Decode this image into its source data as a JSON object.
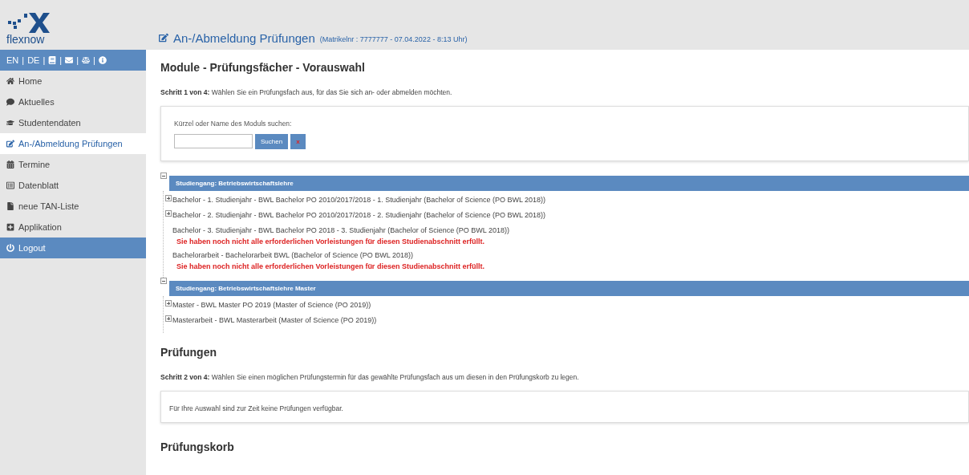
{
  "brand": {
    "name": "flexnow"
  },
  "header": {
    "title": "An-/Abmeldung Prüfungen",
    "subtitle": "(Matrikelnr : 7777777 - 07.04.2022 - 8:13 Uhr)"
  },
  "lang_bar": {
    "separator": "|",
    "items": [
      {
        "kind": "text",
        "label": "EN"
      },
      {
        "kind": "text",
        "label": "DE"
      },
      {
        "kind": "icon"
      },
      {
        "kind": "icon"
      },
      {
        "kind": "icon"
      },
      {
        "kind": "icon"
      }
    ]
  },
  "sidebar": {
    "items": [
      {
        "label": "Home",
        "kind": "link",
        "selected": false
      },
      {
        "label": "Aktuelles",
        "kind": "link",
        "selected": false
      },
      {
        "label": "Studentendaten",
        "kind": "link",
        "selected": false
      },
      {
        "label": "An-/Abmeldung Prüfungen",
        "kind": "link",
        "selected": true
      },
      {
        "label": "Termine",
        "kind": "link",
        "selected": false
      },
      {
        "label": "Datenblatt",
        "kind": "link",
        "selected": false
      },
      {
        "label": "neue TAN-Liste",
        "kind": "link",
        "selected": false
      },
      {
        "label": "Applikation",
        "kind": "link",
        "selected": false
      },
      {
        "label": "Logout",
        "kind": "logout",
        "selected": false
      }
    ]
  },
  "section1": {
    "heading": "Module - Prüfungsfächer - Vorauswahl",
    "step_label": "Schritt 1 von 4:",
    "step_text": "Wählen Sie ein Prüfungsfach aus, für das Sie sich an- oder abmelden möchten.",
    "search": {
      "label": "Kürzel oder Name des Moduls suchen:",
      "button": "Suchen",
      "clear": "x"
    },
    "tree": [
      {
        "label": "Studiengang: Betriebswirtschaftslehre",
        "expanded": true,
        "children": [
          {
            "label": "Bachelor - 1. Studienjahr - BWL Bachelor PO 2010/2017/2018 - 1. Studienjahr (Bachelor of Science (PO BWL 2018))",
            "kind": "branch",
            "expanded": false
          },
          {
            "label": "Bachelor - 2. Studienjahr - BWL Bachelor PO 2010/2017/2018 - 2. Studienjahr (Bachelor of Science (PO BWL 2018))",
            "kind": "branch",
            "expanded": false
          },
          {
            "label": "Bachelor - 3. Studienjahr - BWL Bachelor PO 2018 - 3. Studienjahr (Bachelor of Science (PO BWL 2018))",
            "kind": "leaf",
            "warning": "Sie haben noch nicht alle erforderlichen Vorleistungen für diesen Studienabschnitt erfüllt."
          },
          {
            "label": "Bachelorarbeit - Bachelorarbeit BWL (Bachelor of Science (PO BWL 2018))",
            "kind": "leaf",
            "warning": "Sie haben noch nicht alle erforderlichen Vorleistungen für diesen Studienabschnitt erfüllt."
          }
        ]
      },
      {
        "label": "Studiengang: Betriebswirtschaftslehre Master",
        "expanded": true,
        "children": [
          {
            "label": "Master - BWL Master PO 2019 (Master of Science (PO 2019))",
            "kind": "branch",
            "expanded": false
          },
          {
            "label": "Masterarbeit - BWL Masterarbeit (Master of Science (PO 2019))",
            "kind": "branch",
            "expanded": false
          }
        ]
      }
    ]
  },
  "section2": {
    "heading": "Prüfungen",
    "step_label": "Schritt 2 von 4:",
    "step_text": "Wählen Sie einen möglichen Prüfungstermin für das gewählte Prüfungsfach aus um diesen in den Prüfungskorb zu legen.",
    "notice": "Für Ihre Auswahl sind zur Zeit keine Prüfungen verfügbar."
  },
  "section3": {
    "heading": "Prüfungskorb"
  }
}
